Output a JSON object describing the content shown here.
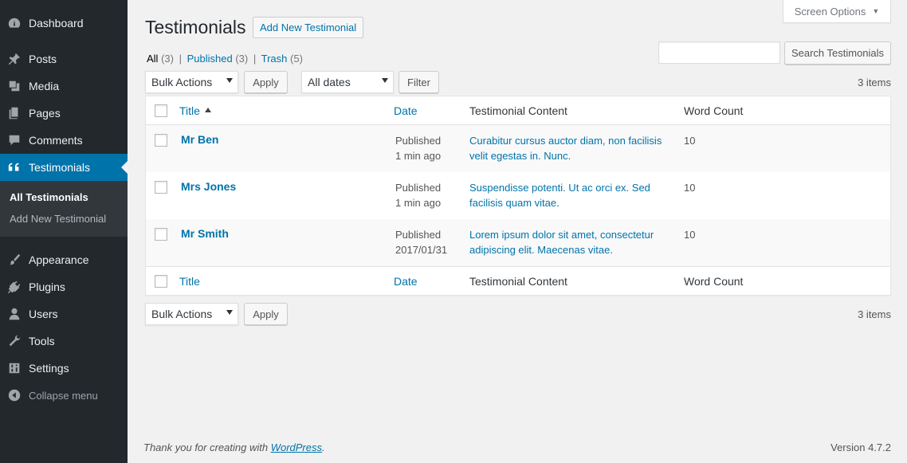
{
  "sidebar": {
    "items": [
      {
        "label": "Dashboard",
        "icon": "dashboard-icon"
      },
      {
        "label": "Posts",
        "icon": "pin-icon"
      },
      {
        "label": "Media",
        "icon": "media-icon"
      },
      {
        "label": "Pages",
        "icon": "pages-icon"
      },
      {
        "label": "Comments",
        "icon": "comment-icon"
      },
      {
        "label": "Testimonials",
        "icon": "quote-icon"
      },
      {
        "label": "Appearance",
        "icon": "paintbrush-icon"
      },
      {
        "label": "Plugins",
        "icon": "plugin-icon"
      },
      {
        "label": "Users",
        "icon": "users-icon"
      },
      {
        "label": "Tools",
        "icon": "wrench-icon"
      },
      {
        "label": "Settings",
        "icon": "settings-icon"
      }
    ],
    "submenu": [
      {
        "label": "All Testimonials"
      },
      {
        "label": "Add New Testimonial"
      }
    ],
    "collapse_label": "Collapse menu"
  },
  "header": {
    "screen_options": "Screen Options",
    "title": "Testimonials",
    "add_new": "Add New Testimonial"
  },
  "views": {
    "all_label": "All",
    "all_count": "(3)",
    "published_label": "Published",
    "published_count": "(3)",
    "trash_label": "Trash",
    "trash_count": "(5)",
    "separator": "|"
  },
  "search": {
    "placeholder": "",
    "button": "Search Testimonials"
  },
  "toolbar": {
    "bulk_actions": "Bulk Actions",
    "apply": "Apply",
    "all_dates": "All dates",
    "filter": "Filter",
    "items_count": "3 items"
  },
  "table": {
    "columns": {
      "title": "Title",
      "date": "Date",
      "content": "Testimonial Content",
      "word_count": "Word Count"
    },
    "rows": [
      {
        "name": "Mr Ben",
        "status": "Published",
        "date": "1 min ago",
        "content": "Curabitur cursus auctor diam, non facilisis velit egestas in. Nunc.",
        "word_count": "10"
      },
      {
        "name": "Mrs Jones",
        "status": "Published",
        "date": "1 min ago",
        "content": "Suspendisse potenti. Ut ac orci ex. Sed facilisis quam vitae.",
        "word_count": "10"
      },
      {
        "name": "Mr Smith",
        "status": "Published",
        "date": "2017/01/31",
        "content": "Lorem ipsum dolor sit amet, consectetur adipiscing elit. Maecenas vitae.",
        "word_count": "10"
      }
    ]
  },
  "footer": {
    "thanks_prefix": "Thank you for creating with ",
    "thanks_link": "WordPress",
    "thanks_suffix": ".",
    "version": "Version 4.7.2"
  },
  "colors": {
    "sidebar_bg": "#23282d",
    "accent": "#0073aa",
    "submenu_bg": "#32373c"
  }
}
